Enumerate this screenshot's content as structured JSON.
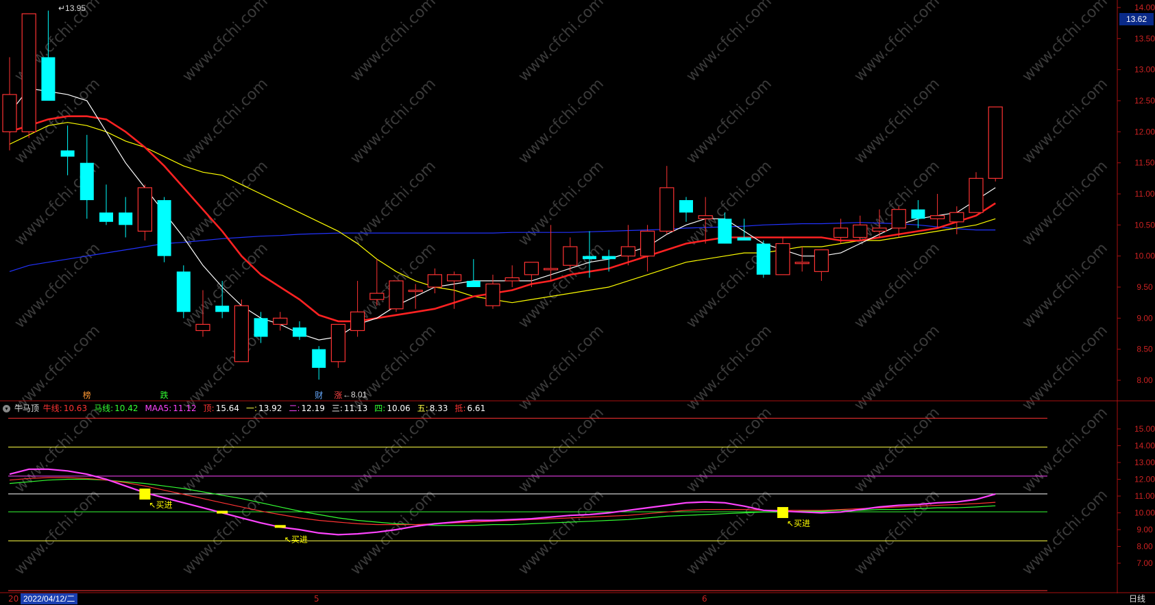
{
  "header": {
    "current_price": "13.62",
    "high_label": "13.95",
    "low_label": "8.01"
  },
  "event_markers": [
    {
      "label": "榜",
      "color": "#ff9933",
      "index": 4
    },
    {
      "label": "跌",
      "color": "#33ff33",
      "index": 8
    },
    {
      "label": "财",
      "color": "#66aaff",
      "index": 16
    },
    {
      "label": "涨",
      "color": "#ff4444",
      "index": 17
    }
  ],
  "indicator": {
    "name": "牛马顶",
    "items": [
      {
        "label": "牛线:",
        "value": "10.63",
        "color": "#ff3333"
      },
      {
        "label": "马线:",
        "value": "10.42",
        "color": "#33ff33"
      },
      {
        "label": "MAA5:",
        "value": "11.12",
        "color": "#ff44ff"
      },
      {
        "label": "顶:",
        "value": "15.64",
        "color": "#ff3333"
      },
      {
        "label": "一:",
        "value": "13.92",
        "color": "#ffff44"
      },
      {
        "label": "二:",
        "value": "12.19",
        "color": "#ff44ff"
      },
      {
        "label": "三:",
        "value": "11.13",
        "color": "#ffffff"
      },
      {
        "label": "四:",
        "value": "10.06",
        "color": "#33ff33"
      },
      {
        "label": "五:",
        "value": "8.33",
        "color": "#ffff44"
      },
      {
        "label": "抵:",
        "value": "6.61",
        "color": "#ff3333"
      }
    ],
    "buy_label": "买进"
  },
  "footer": {
    "date": "2022/04/12/二",
    "year_stub": "20",
    "month_marks": [
      "5",
      "6"
    ],
    "period": "日线"
  },
  "watermark": "www.cfchi.com",
  "chart_data": [
    {
      "type": "candlestick",
      "title": "",
      "ylim": [
        7.7,
        14.0
      ],
      "y_ticks": [
        "8.00",
        "8.50",
        "9.00",
        "9.50",
        "10.00",
        "10.50",
        "11.00",
        "11.50",
        "12.00",
        "12.50",
        "13.00",
        "13.50",
        "14.00"
      ],
      "colors": {
        "up": "#ff3333",
        "down": "#00ffff",
        "ma5": "#ffffff",
        "ma10": "#ff2222",
        "ma20": "#ffff00",
        "ma60": "#2233ff"
      },
      "ohlc": [
        [
          12.0,
          13.2,
          11.7,
          12.6
        ],
        [
          12.0,
          13.9,
          11.9,
          13.9
        ],
        [
          13.2,
          13.95,
          12.5,
          12.5
        ],
        [
          11.7,
          12.1,
          11.3,
          11.6
        ],
        [
          11.5,
          11.95,
          10.6,
          10.9
        ],
        [
          10.7,
          11.15,
          10.5,
          10.55
        ],
        [
          10.7,
          10.95,
          10.3,
          10.5
        ],
        [
          10.4,
          11.15,
          10.25,
          11.1
        ],
        [
          10.9,
          10.95,
          9.9,
          10.0
        ],
        [
          9.75,
          9.85,
          9.0,
          9.1
        ],
        [
          8.8,
          9.45,
          8.7,
          8.9
        ],
        [
          9.2,
          9.6,
          9.0,
          9.1
        ],
        [
          8.3,
          9.3,
          8.3,
          9.2
        ],
        [
          9.0,
          9.1,
          8.6,
          8.7
        ],
        [
          8.9,
          9.1,
          8.8,
          9.0
        ],
        [
          8.85,
          8.95,
          8.65,
          8.7
        ],
        [
          8.5,
          8.55,
          8.01,
          8.2
        ],
        [
          8.3,
          8.9,
          8.2,
          8.9
        ],
        [
          8.8,
          9.6,
          8.7,
          9.1
        ],
        [
          9.3,
          9.95,
          9.2,
          9.4
        ],
        [
          9.15,
          9.6,
          9.1,
          9.6
        ],
        [
          9.45,
          9.55,
          9.15,
          9.45
        ],
        [
          9.5,
          9.8,
          9.4,
          9.7
        ],
        [
          9.6,
          9.75,
          9.15,
          9.7
        ],
        [
          9.6,
          9.95,
          9.55,
          9.5
        ],
        [
          9.2,
          9.7,
          9.15,
          9.55
        ],
        [
          9.6,
          9.85,
          9.5,
          9.65
        ],
        [
          9.7,
          9.9,
          9.5,
          9.9
        ],
        [
          9.8,
          10.5,
          9.6,
          9.8
        ],
        [
          9.85,
          10.3,
          9.75,
          10.15
        ],
        [
          10.0,
          10.4,
          9.65,
          9.95
        ],
        [
          10.0,
          10.1,
          9.75,
          9.95
        ],
        [
          10.0,
          10.5,
          9.85,
          10.15
        ],
        [
          10.0,
          10.5,
          9.75,
          10.4
        ],
        [
          10.4,
          11.45,
          10.35,
          11.1
        ],
        [
          10.9,
          10.95,
          10.55,
          10.7
        ],
        [
          10.6,
          10.95,
          10.2,
          10.65
        ],
        [
          10.6,
          10.7,
          10.2,
          10.2
        ],
        [
          10.3,
          10.6,
          10.25,
          10.25
        ],
        [
          10.2,
          10.25,
          9.65,
          9.7
        ],
        [
          9.7,
          10.3,
          9.7,
          10.2
        ],
        [
          9.9,
          10.15,
          9.75,
          9.9
        ],
        [
          9.75,
          10.1,
          9.6,
          10.1
        ],
        [
          10.3,
          10.6,
          10.2,
          10.45
        ],
        [
          10.3,
          10.65,
          10.25,
          10.5
        ],
        [
          10.4,
          10.75,
          10.3,
          10.45
        ],
        [
          10.45,
          10.8,
          10.3,
          10.75
        ],
        [
          10.75,
          10.9,
          10.45,
          10.6
        ],
        [
          10.6,
          11.0,
          10.45,
          10.65
        ],
        [
          10.55,
          10.8,
          10.35,
          10.7
        ],
        [
          10.7,
          11.35,
          10.7,
          11.25
        ],
        [
          11.25,
          12.4,
          11.2,
          12.4
        ]
      ],
      "ma5": [
        12.3,
        12.7,
        12.65,
        12.6,
        12.5,
        12.0,
        11.5,
        11.1,
        10.7,
        10.3,
        9.85,
        9.5,
        9.2,
        9.0,
        8.9,
        8.75,
        8.65,
        8.7,
        8.9,
        9.0,
        9.2,
        9.35,
        9.5,
        9.55,
        9.6,
        9.6,
        9.6,
        9.6,
        9.7,
        9.8,
        9.9,
        9.95,
        10.05,
        10.15,
        10.35,
        10.5,
        10.6,
        10.6,
        10.4,
        10.2,
        10.1,
        10.0,
        10.0,
        10.05,
        10.2,
        10.35,
        10.5,
        10.6,
        10.65,
        10.7,
        10.9,
        11.1
      ],
      "ma10": [
        12.0,
        12.1,
        12.2,
        12.25,
        12.25,
        12.2,
        12.0,
        11.75,
        11.45,
        11.1,
        10.75,
        10.4,
        10.0,
        9.7,
        9.5,
        9.3,
        9.05,
        8.95,
        8.95,
        9.0,
        9.05,
        9.1,
        9.15,
        9.25,
        9.35,
        9.4,
        9.45,
        9.55,
        9.6,
        9.7,
        9.75,
        9.8,
        9.9,
        10.0,
        10.1,
        10.2,
        10.25,
        10.3,
        10.3,
        10.3,
        10.3,
        10.3,
        10.3,
        10.25,
        10.25,
        10.3,
        10.35,
        10.4,
        10.45,
        10.55,
        10.65,
        10.85
      ],
      "ma20": [
        11.8,
        11.95,
        12.1,
        12.15,
        12.1,
        12.0,
        11.85,
        11.75,
        11.6,
        11.45,
        11.35,
        11.3,
        11.15,
        11.0,
        10.85,
        10.7,
        10.55,
        10.4,
        10.2,
        9.95,
        9.75,
        9.6,
        9.5,
        9.45,
        9.35,
        9.3,
        9.25,
        9.3,
        9.35,
        9.4,
        9.45,
        9.5,
        9.6,
        9.7,
        9.8,
        9.9,
        9.95,
        10.0,
        10.05,
        10.05,
        10.1,
        10.15,
        10.15,
        10.2,
        10.25,
        10.25,
        10.3,
        10.35,
        10.4,
        10.45,
        10.5,
        10.6
      ],
      "ma60": [
        9.75,
        9.85,
        9.9,
        9.95,
        10.0,
        10.05,
        10.1,
        10.15,
        10.2,
        10.22,
        10.25,
        10.28,
        10.3,
        10.32,
        10.33,
        10.35,
        10.36,
        10.37,
        10.37,
        10.37,
        10.37,
        10.37,
        10.37,
        10.37,
        10.37,
        10.37,
        10.38,
        10.38,
        10.38,
        10.38,
        10.39,
        10.4,
        10.41,
        10.42,
        10.43,
        10.45,
        10.46,
        10.47,
        10.48,
        10.5,
        10.51,
        10.52,
        10.52,
        10.53,
        10.54,
        10.53,
        10.52,
        10.5,
        10.47,
        10.44,
        10.42,
        10.42
      ]
    },
    {
      "type": "line",
      "title": "",
      "ylim": [
        6.6,
        16.3
      ],
      "y_ticks": [
        "7.00",
        "8.00",
        "9.00",
        "10.00",
        "11.00",
        "12.00",
        "13.00",
        "14.00",
        "15.00"
      ],
      "levels": [
        {
          "name": "顶",
          "value": 15.64,
          "color": "#ff3333"
        },
        {
          "name": "一",
          "value": 13.92,
          "color": "#ffff44"
        },
        {
          "name": "二",
          "value": 12.19,
          "color": "#ff44ff"
        },
        {
          "name": "三",
          "value": 11.13,
          "color": "#ffffff"
        },
        {
          "name": "四",
          "value": 10.06,
          "color": "#33ff33"
        },
        {
          "name": "五",
          "value": 8.33,
          "color": "#ffff44"
        },
        {
          "name": "抵",
          "value": 6.61,
          "color": "#ff3333"
        }
      ],
      "series": [
        {
          "name": "MAA5",
          "color": "#ff44ff",
          "values": [
            12.3,
            12.6,
            12.6,
            12.5,
            12.3,
            12.0,
            11.6,
            11.2,
            10.9,
            10.6,
            10.3,
            10.0,
            9.7,
            9.4,
            9.15,
            9.0,
            8.8,
            8.7,
            8.75,
            8.85,
            9.0,
            9.2,
            9.35,
            9.45,
            9.55,
            9.55,
            9.6,
            9.65,
            9.75,
            9.85,
            9.9,
            10.0,
            10.15,
            10.3,
            10.45,
            10.6,
            10.65,
            10.6,
            10.4,
            10.15,
            10.1,
            10.05,
            10.0,
            10.05,
            10.2,
            10.35,
            10.45,
            10.5,
            10.6,
            10.65,
            10.8,
            11.12
          ]
        },
        {
          "name": "牛线",
          "color": "#ff3333",
          "values": [
            11.95,
            12.05,
            12.1,
            12.1,
            12.05,
            11.95,
            11.8,
            11.6,
            11.35,
            11.1,
            10.85,
            10.6,
            10.35,
            10.1,
            9.9,
            9.7,
            9.55,
            9.45,
            9.35,
            9.3,
            9.3,
            9.3,
            9.35,
            9.4,
            9.45,
            9.5,
            9.55,
            9.6,
            9.65,
            9.7,
            9.75,
            9.8,
            9.85,
            9.95,
            10.05,
            10.15,
            10.2,
            10.2,
            10.2,
            10.15,
            10.15,
            10.15,
            10.15,
            10.2,
            10.25,
            10.3,
            10.35,
            10.4,
            10.45,
            10.5,
            10.55,
            10.63
          ]
        },
        {
          "name": "马线",
          "color": "#33ff33",
          "values": [
            11.75,
            11.85,
            11.95,
            12.0,
            12.0,
            11.95,
            11.85,
            11.75,
            11.6,
            11.45,
            11.25,
            11.05,
            10.85,
            10.6,
            10.35,
            10.1,
            9.9,
            9.7,
            9.55,
            9.45,
            9.35,
            9.3,
            9.25,
            9.25,
            9.25,
            9.3,
            9.3,
            9.35,
            9.4,
            9.45,
            9.5,
            9.55,
            9.6,
            9.7,
            9.8,
            9.85,
            9.9,
            9.95,
            10.0,
            10.05,
            10.05,
            10.1,
            10.1,
            10.15,
            10.15,
            10.2,
            10.2,
            10.25,
            10.3,
            10.3,
            10.35,
            10.42
          ]
        }
      ],
      "buy_signals": [
        7,
        11,
        14,
        40
      ]
    }
  ]
}
